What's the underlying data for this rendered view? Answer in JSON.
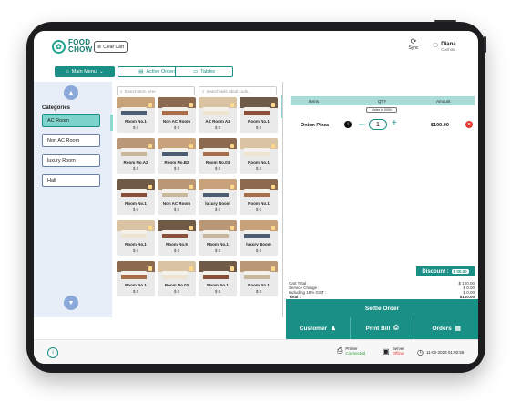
{
  "header": {
    "logo_line1": "FOOD",
    "logo_line2": "CHOW",
    "clear_cart": "Clear Cart",
    "sync": "Sync",
    "user_name": "Diana",
    "user_role": "Cashier"
  },
  "nav": {
    "main_menu": "Main Menu",
    "active_orders": "Active Orders",
    "tables": "Tables"
  },
  "categories": {
    "title": "Categories",
    "items": [
      "AC Room",
      "Non AC Room",
      "luxury Room",
      "Hall"
    ]
  },
  "search": {
    "item_placeholder": "Search item here",
    "ubar_placeholder": "Search with ubarl code..."
  },
  "rooms": [
    {
      "name": "Room No.1",
      "price": "$ 0"
    },
    {
      "name": "Non AC Room",
      "price": "$ 0"
    },
    {
      "name": "AC Room A2",
      "price": "$ 0"
    },
    {
      "name": "Room No.1",
      "price": "$ 0"
    },
    {
      "name": "Room No.A2",
      "price": "$ 0"
    },
    {
      "name": "Room No.B2",
      "price": "$ 0"
    },
    {
      "name": "Room No.03",
      "price": "$ 0"
    },
    {
      "name": "Room No.1",
      "price": "$ 0"
    },
    {
      "name": "Room No.1",
      "price": "$ 0"
    },
    {
      "name": "Non AC Room",
      "price": "$ 0"
    },
    {
      "name": "luxury Room",
      "price": "$ 0"
    },
    {
      "name": "Room No.1",
      "price": "$ 0"
    },
    {
      "name": "Room No.1",
      "price": "$ 0"
    },
    {
      "name": "Room No.5",
      "price": "$ 0"
    },
    {
      "name": "Room No.1",
      "price": "$ 0"
    },
    {
      "name": "luxury Room",
      "price": "$ 0"
    },
    {
      "name": "Room No.1",
      "price": "$ 0"
    },
    {
      "name": "Room No.02",
      "price": "$ 0"
    },
    {
      "name": "Room No.1",
      "price": "$ 0"
    },
    {
      "name": "Room No.1",
      "price": "$ 0"
    }
  ],
  "order": {
    "col_items": "Items",
    "col_qty": "QTY",
    "col_amount": "Amount",
    "order_id": "Order Id 0000",
    "item_name": "Onion Pizza",
    "item_qty": "1",
    "item_price": "$100.00",
    "discount_label": "Discount :",
    "discount_value": "$ 00.00",
    "cart_total_label": "Cart Total :",
    "cart_total": "$ 100.00",
    "service_label": "Service Charge :",
    "service": "$ 0.00",
    "gst_label": "Including 18% GST :",
    "gst": "$ 0.00",
    "total_label": "Total :",
    "total": "$100.00",
    "settle": "Settle Order",
    "customer": "Customer",
    "print_bill": "Print Bill",
    "orders": "Orders"
  },
  "footer": {
    "printer_label": "Printer",
    "printer_status": "Connected",
    "server_label": "Server",
    "server_status": "Offline",
    "datetime": "11-02-2023  01:02:55"
  },
  "colors": {
    "accent": "#1a8f85",
    "light_accent": "#a9dcd6",
    "category_bg": "#e7eef8",
    "danger": "#e53935"
  }
}
